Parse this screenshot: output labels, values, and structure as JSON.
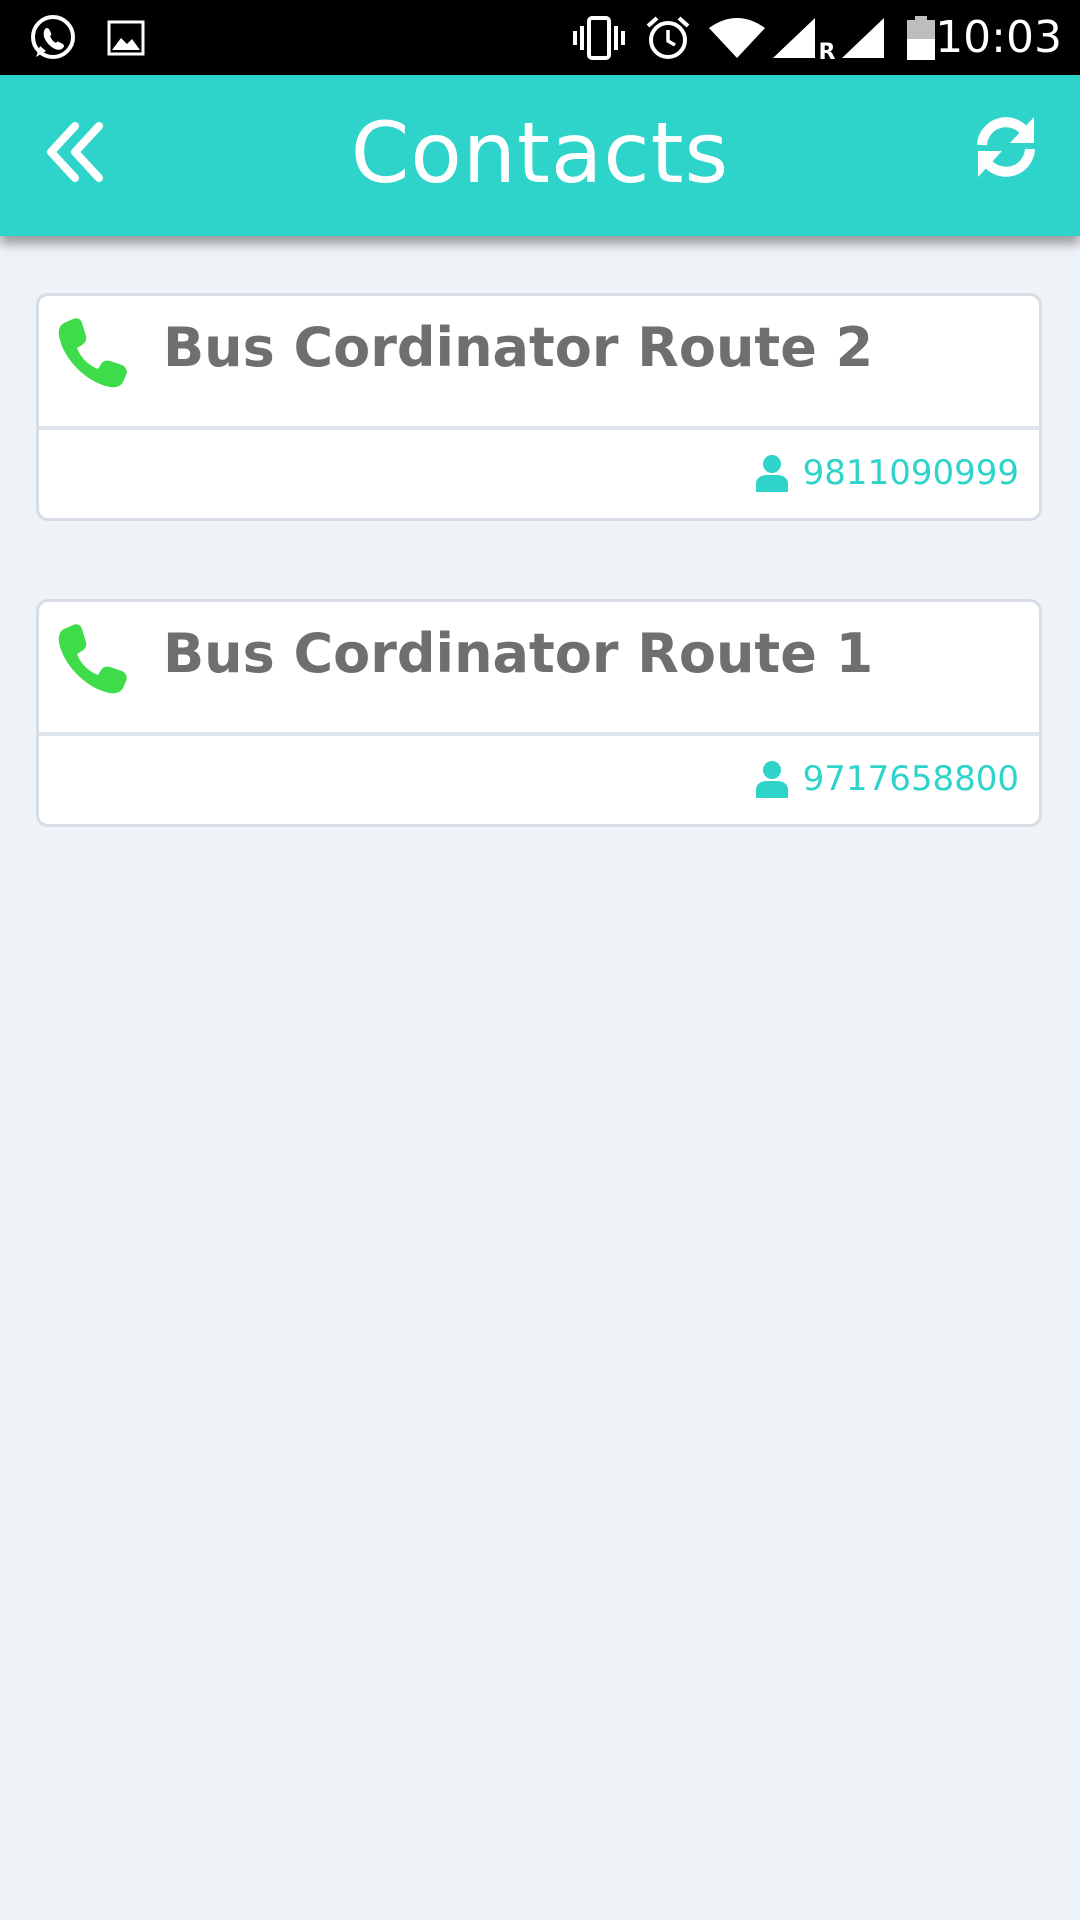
{
  "status_bar": {
    "time": "10:03",
    "icons": [
      "whatsapp-icon",
      "gallery-icon",
      "vibrate-icon",
      "alarm-icon",
      "wifi-icon",
      "signal-icon",
      "roaming-indicator",
      "signal-icon",
      "battery-icon"
    ],
    "roaming_label": "R"
  },
  "app_bar": {
    "title": "Contacts",
    "back_icon": "double-chevron-left-icon",
    "refresh_icon": "refresh-icon",
    "background_color": "#2ed3c9"
  },
  "contacts": [
    {
      "name": "Bus Cordinator Route 2",
      "number": "9811090999"
    },
    {
      "name": "Bus Cordinator Route 1",
      "number": "9717658800"
    }
  ],
  "colors": {
    "accent": "#2ed3c9",
    "phone_icon": "#3fdc4a",
    "title_text": "#6f6f6f",
    "background": "#eef3f7"
  }
}
